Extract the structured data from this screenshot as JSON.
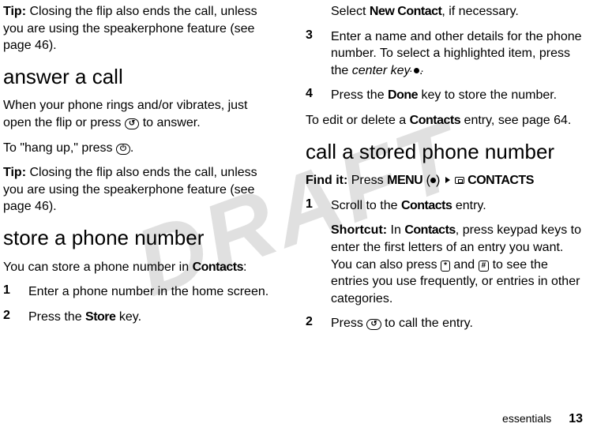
{
  "watermark": "DRAFT",
  "left": {
    "tip1_label": "Tip:",
    "tip1_body": " Closing the flip also ends the call, unless you are using the speakerphone feature (see page 46).",
    "h_answer": "answer a call",
    "answer_p1a": "When your phone rings and/or vibrates, just open the flip or press ",
    "answer_p1b": " to answer.",
    "hangup_a": "To \"hang up,\" press ",
    "hangup_b": ".",
    "tip2_label": "Tip:",
    "tip2_body": " Closing the flip also ends the call, unless you are using the speakerphone feature (see page 46).",
    "h_store": "store a phone number",
    "store_p1a": "You can store a phone number in ",
    "store_contacts": "Contacts",
    "store_p1b": ":",
    "step1_num": "1",
    "step1_body": "Enter a phone number in the home screen.",
    "step2_num": "2",
    "step2_a": "Press the ",
    "step2_store": "Store",
    "step2_b": " key."
  },
  "right": {
    "sel_a": "Select ",
    "sel_new": "New Contact",
    "sel_b": ", if necessary.",
    "step3_num": "3",
    "step3_a": "Enter a name and other details for the phone number. To select a highlighted item, press the ",
    "step3_center": "center key",
    "step3_b": ".",
    "step4_num": "4",
    "step4_a": "Press the ",
    "step4_done": "Done",
    "step4_b": " key to store the number.",
    "edit_a": "To edit or delete a ",
    "edit_contacts": "Contacts",
    "edit_b": " entry, see page 64.",
    "h_call": "call a stored phone number",
    "find_label": "Find it:",
    "find_a": " Press ",
    "find_menu": "MENU",
    "find_paren_open": "(",
    "find_paren_close": ")",
    "find_contacts": " CONTACTS",
    "cstep1_num": "1",
    "cstep1_a": "Scroll to the ",
    "cstep1_contacts": "Contacts",
    "cstep1_b": " entry.",
    "shortcut_label": "Shortcut:",
    "shortcut_a": " In ",
    "shortcut_contacts": "Contacts",
    "shortcut_b": ", press keypad keys to enter the first letters of an entry you want. You can also press ",
    "shortcut_c": " and ",
    "shortcut_d": " to see the entries you use frequently, or entries in other categories.",
    "cstep2_num": "2",
    "cstep2_a": "Press ",
    "cstep2_b": " to call the entry."
  },
  "keys": {
    "send": "↺",
    "end": "⏻",
    "star": "*",
    "hash": "#"
  },
  "footer": {
    "section": "essentials",
    "page": "13"
  }
}
